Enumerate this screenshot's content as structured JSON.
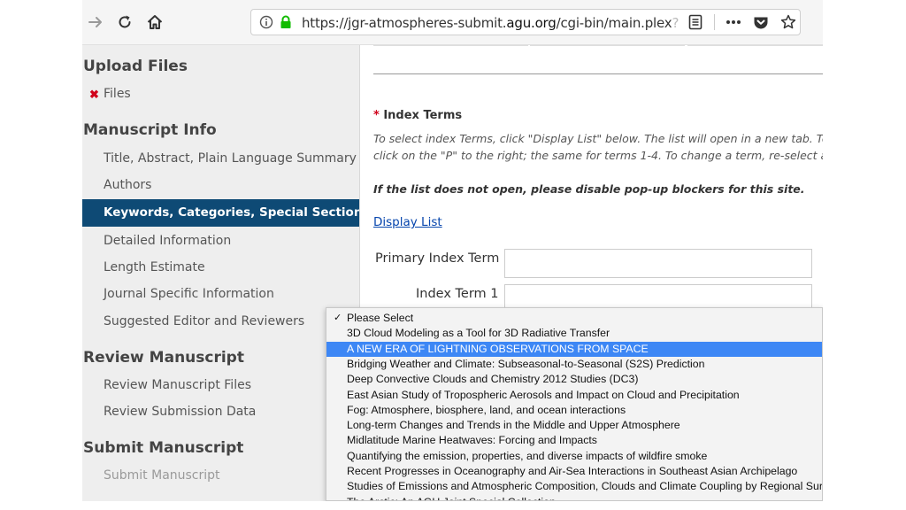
{
  "browser": {
    "url_prefix": "https://jgr-atmospheres-submit.",
    "url_domain": "agu.org",
    "url_path": "/cgi-bin/main.plex",
    "url_fade": "?",
    "icons": [
      "forward-arrow-icon",
      "reload-icon",
      "home-icon",
      "info-icon",
      "lock-icon",
      "reader-view-icon",
      "more-icon",
      "pocket-icon",
      "bookmark-star-icon"
    ]
  },
  "sidebar": {
    "upload": {
      "heading": "Upload Files",
      "items": [
        {
          "label": "Files",
          "status": "incomplete"
        }
      ]
    },
    "manuscript_info": {
      "heading": "Manuscript Info",
      "items": [
        {
          "label": "Title, Abstract, Plain Language Summary"
        },
        {
          "label": "Authors"
        },
        {
          "label": "Keywords, Categories, Special Sections",
          "active": true
        },
        {
          "label": "Detailed Information"
        },
        {
          "label": "Length Estimate"
        },
        {
          "label": "Journal Specific Information"
        },
        {
          "label": "Suggested Editor and Reviewers"
        }
      ]
    },
    "review": {
      "heading": "Review Manuscript",
      "items": [
        {
          "label": "Review Manuscript Files"
        },
        {
          "label": "Review Submission Data"
        }
      ]
    },
    "submit": {
      "heading": "Submit Manuscript",
      "items": [
        {
          "label": "Submit Manuscript",
          "disabled": true
        }
      ]
    }
  },
  "main": {
    "required_mark": "*",
    "index_terms_title": "Index Terms",
    "instruction_line1": "To select index Terms, click \"Display List\" below. The list will open in a new tab. To s",
    "instruction_line2": "click on the \"P\" to the right; the same for terms 1-4. To change a term, re-select a n",
    "popup_note": "If the list does not open, please disable pop-up blockers for this site.",
    "display_list_link": "Display List",
    "fields": [
      {
        "label": "Primary Index Term",
        "value": ""
      },
      {
        "label": "Index Term 1",
        "value": ""
      }
    ]
  },
  "dropdown": {
    "checkmark": "✓",
    "checked_index": 0,
    "highlighted_index": 2,
    "options": [
      "Please Select",
      "3D Cloud Modeling as a Tool for 3D Radiative Transfer",
      "A NEW ERA OF LIGHTNING OBSERVATIONS FROM SPACE",
      "Bridging Weather and Climate: Subseasonal-to-Seasonal (S2S) Prediction",
      "Deep Convective Clouds and Chemistry 2012 Studies (DC3)",
      "East Asian Study of Tropospheric Aerosols and Impact on Cloud and Precipitation",
      "Fog: Atmosphere, biosphere, land, and ocean interactions",
      "Long-term Changes and Trends in the Middle and Upper Atmosphere",
      "Midlatitude Marine Heatwaves: Forcing and Impacts",
      "Quantifying the emission, properties, and diverse impacts of wildfire smoke",
      "Recent Progresses in Oceanography and Air-Sea Interactions in Southeast Asian Archipelago",
      "Studies of Emissions and Atmospheric Composition, Clouds and Climate Coupling by Regional Surv",
      "The Arctic: An AGU Joint Special Collection"
    ]
  }
}
